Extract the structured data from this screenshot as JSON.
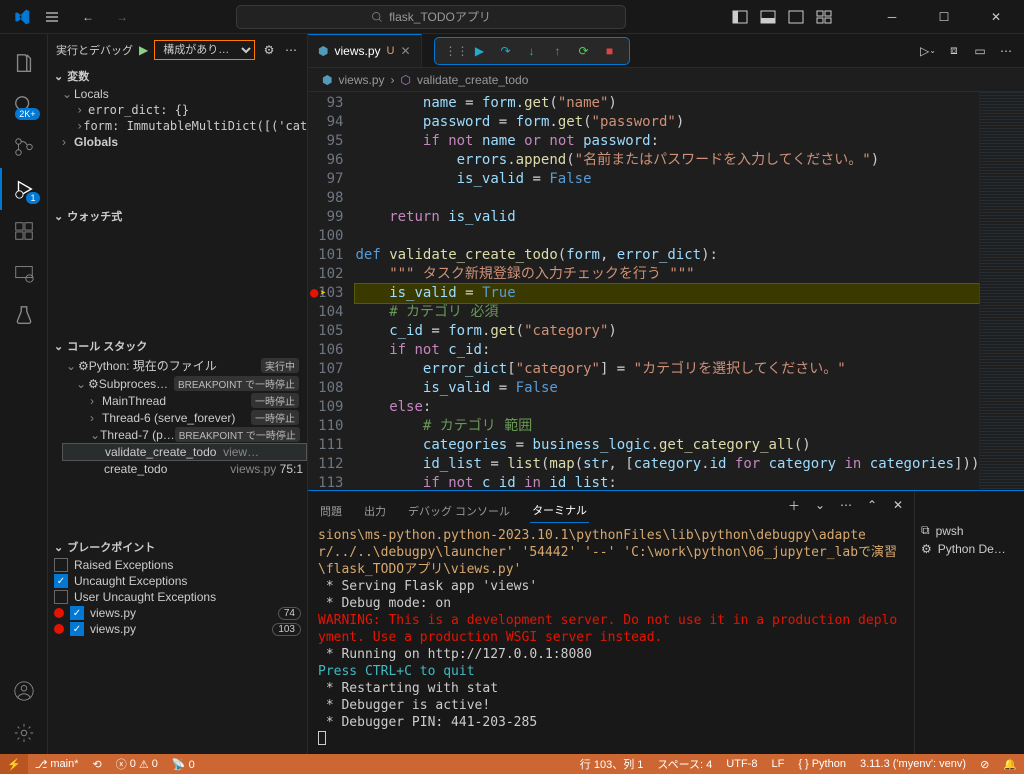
{
  "titlebar": {
    "search_text": "flask_TODOアプリ"
  },
  "sidebar": {
    "run_debug_label": "実行とデバッグ",
    "config_text": "構成があり…",
    "sections": {
      "variables": "変数",
      "locals": "Locals",
      "error_dict": "error_dict: {}",
      "form": "form: ImmutableMultiDict([('cat…",
      "globals": "Globals",
      "watch": "ウォッチ式",
      "callstack": "コール スタック",
      "breakpoints": "ブレークポイント"
    },
    "callstack_items": {
      "python_current": "Python: 現在のファイル",
      "running": "実行中",
      "subprocess": "Subproces…",
      "bp_paused": "BREAKPOINT で一時停止",
      "main_thread": "MainThread",
      "paused": "一時停止",
      "thread6": "Thread-6 (serve_forever)",
      "thread7": "Thread-7 (p…",
      "frame1": "validate_create_todo",
      "frame1_file": "view…",
      "frame2": "create_todo",
      "frame2_file": "views.py",
      "frame2_line": "75:1"
    },
    "breakpoints_items": {
      "raised": "Raised Exceptions",
      "uncaught": "Uncaught Exceptions",
      "user_uncaught": "User Uncaught Exceptions",
      "bp1_file": "views.py",
      "bp1_line": "74",
      "bp2_file": "views.py",
      "bp2_line": "103"
    }
  },
  "activitybar": {
    "search_badge": "2K+",
    "debug_badge": "1"
  },
  "editor": {
    "tab_name": "views.py",
    "tab_modified": "U",
    "breadcrumb_file": "views.py",
    "breadcrumb_symbol": "validate_create_todo",
    "lines": {
      "93": {
        "n": "93",
        "html": "        <span class='nm'>name</span> <span class='op'>=</span> <span class='nm'>form</span>.<span class='fn'>get</span>(<span class='str'>\"name\"</span>)"
      },
      "94": {
        "n": "94",
        "html": "        <span class='nm'>password</span> <span class='op'>=</span> <span class='nm'>form</span>.<span class='fn'>get</span>(<span class='str'>\"password\"</span>)"
      },
      "95": {
        "n": "95",
        "html": "        <span class='kw'>if</span> <span class='kw'>not</span> <span class='nm'>name</span> <span class='kw'>or</span> <span class='kw'>not</span> <span class='nm'>password</span>:"
      },
      "96": {
        "n": "96",
        "html": "            <span class='nm'>errors</span>.<span class='fn'>append</span>(<span class='str'>\"名前またはパスワードを入力してください。\"</span>)"
      },
      "97": {
        "n": "97",
        "html": "            <span class='nm'>is_valid</span> <span class='op'>=</span> <span class='bool'>False</span>"
      },
      "98": {
        "n": "98",
        "html": ""
      },
      "99": {
        "n": "99",
        "html": "    <span class='kw'>return</span> <span class='nm'>is_valid</span>"
      },
      "100": {
        "n": "100",
        "html": ""
      },
      "101": {
        "n": "101",
        "html": "<span class='def'>def</span> <span class='fn'>validate_create_todo</span>(<span class='nm'>form</span>, <span class='nm'>error_dict</span>):"
      },
      "102": {
        "n": "102",
        "html": "    <span class='str'>\"\"\" タスク新規登録の入力チェックを行う \"\"\"</span>"
      },
      "103": {
        "n": "103",
        "html": "    <span class='nm'>is_valid</span> <span class='op'>=</span> <span class='bool'>True</span>"
      },
      "104": {
        "n": "104",
        "html": "    <span class='cm'># カテゴリ 必須</span>"
      },
      "105": {
        "n": "105",
        "html": "    <span class='nm'>c_id</span> <span class='op'>=</span> <span class='nm'>form</span>.<span class='fn'>get</span>(<span class='str'>\"category\"</span>)"
      },
      "106": {
        "n": "106",
        "html": "    <span class='kw'>if</span> <span class='kw'>not</span> <span class='nm'>c_id</span>:"
      },
      "107": {
        "n": "107",
        "html": "        <span class='nm'>error_dict</span>[<span class='str'>\"category\"</span>] <span class='op'>=</span> <span class='str'>\"カテゴリを選択してください。\"</span>"
      },
      "108": {
        "n": "108",
        "html": "        <span class='nm'>is_valid</span> <span class='op'>=</span> <span class='bool'>False</span>"
      },
      "109": {
        "n": "109",
        "html": "    <span class='kw'>else</span>:"
      },
      "110": {
        "n": "110",
        "html": "        <span class='cm'># カテゴリ 範囲</span>"
      },
      "111": {
        "n": "111",
        "html": "        <span class='nm'>categories</span> <span class='op'>=</span> <span class='nm'>business_logic</span>.<span class='fn'>get_category_all</span>()"
      },
      "112": {
        "n": "112",
        "html": "        <span class='nm'>id_list</span> <span class='op'>=</span> <span class='fn'>list</span>(<span class='fn'>map</span>(<span class='nm'>str</span>, [<span class='nm'>category</span>.<span class='nm'>id</span> <span class='kw'>for</span> <span class='nm'>category</span> <span class='kw'>in</span> <span class='nm'>categories</span>]))"
      },
      "113": {
        "n": "113",
        "html": "        <span class='kw'>if</span> <span class='kw'>not</span> <span class='nm'>c_id</span> <span class='kw'>in</span> <span class='nm'>id_list</span>:"
      }
    }
  },
  "panel": {
    "tabs": {
      "problems": "問題",
      "output": "出力",
      "debug_console": "デバッグ コンソール",
      "terminal": "ターミナル"
    },
    "side": {
      "pwsh": "pwsh",
      "python_debug": "Python De…"
    },
    "terminal_lines": [
      {
        "cls": "t-yellow",
        "text": "sions\\ms-python.python-2023.10.1\\pythonFiles\\lib\\python\\debugpy\\adapter/../..\\debugpy\\launcher' '54442' '--' 'C:\\work\\python\\06_jupyter_labで演習\\flask_TODOアプリ\\views.py'"
      },
      {
        "cls": "t-white",
        "text": " * Serving Flask app 'views'"
      },
      {
        "cls": "t-white",
        "text": " * Debug mode: on"
      },
      {
        "cls": "t-red",
        "text": "WARNING: This is a development server. Do not use it in a production deployment. Use a production WSGI server instead."
      },
      {
        "cls": "t-white",
        "text": " * Running on http://127.0.0.1:8080"
      },
      {
        "cls": "t-cyan",
        "text": "Press CTRL+C to quit"
      },
      {
        "cls": "t-white",
        "text": " * Restarting with stat"
      },
      {
        "cls": "t-white",
        "text": " * Debugger is active!"
      },
      {
        "cls": "t-white",
        "text": " * Debugger PIN: 441-203-285"
      }
    ]
  },
  "statusbar": {
    "branch": "main*",
    "errors": "0",
    "warnings": "0",
    "position": "行 103、列 1",
    "spaces": "スペース: 4",
    "encoding": "UTF-8",
    "eol": "LF",
    "lang": "Python",
    "python_version": "3.11.3 ('myenv': venv)"
  }
}
